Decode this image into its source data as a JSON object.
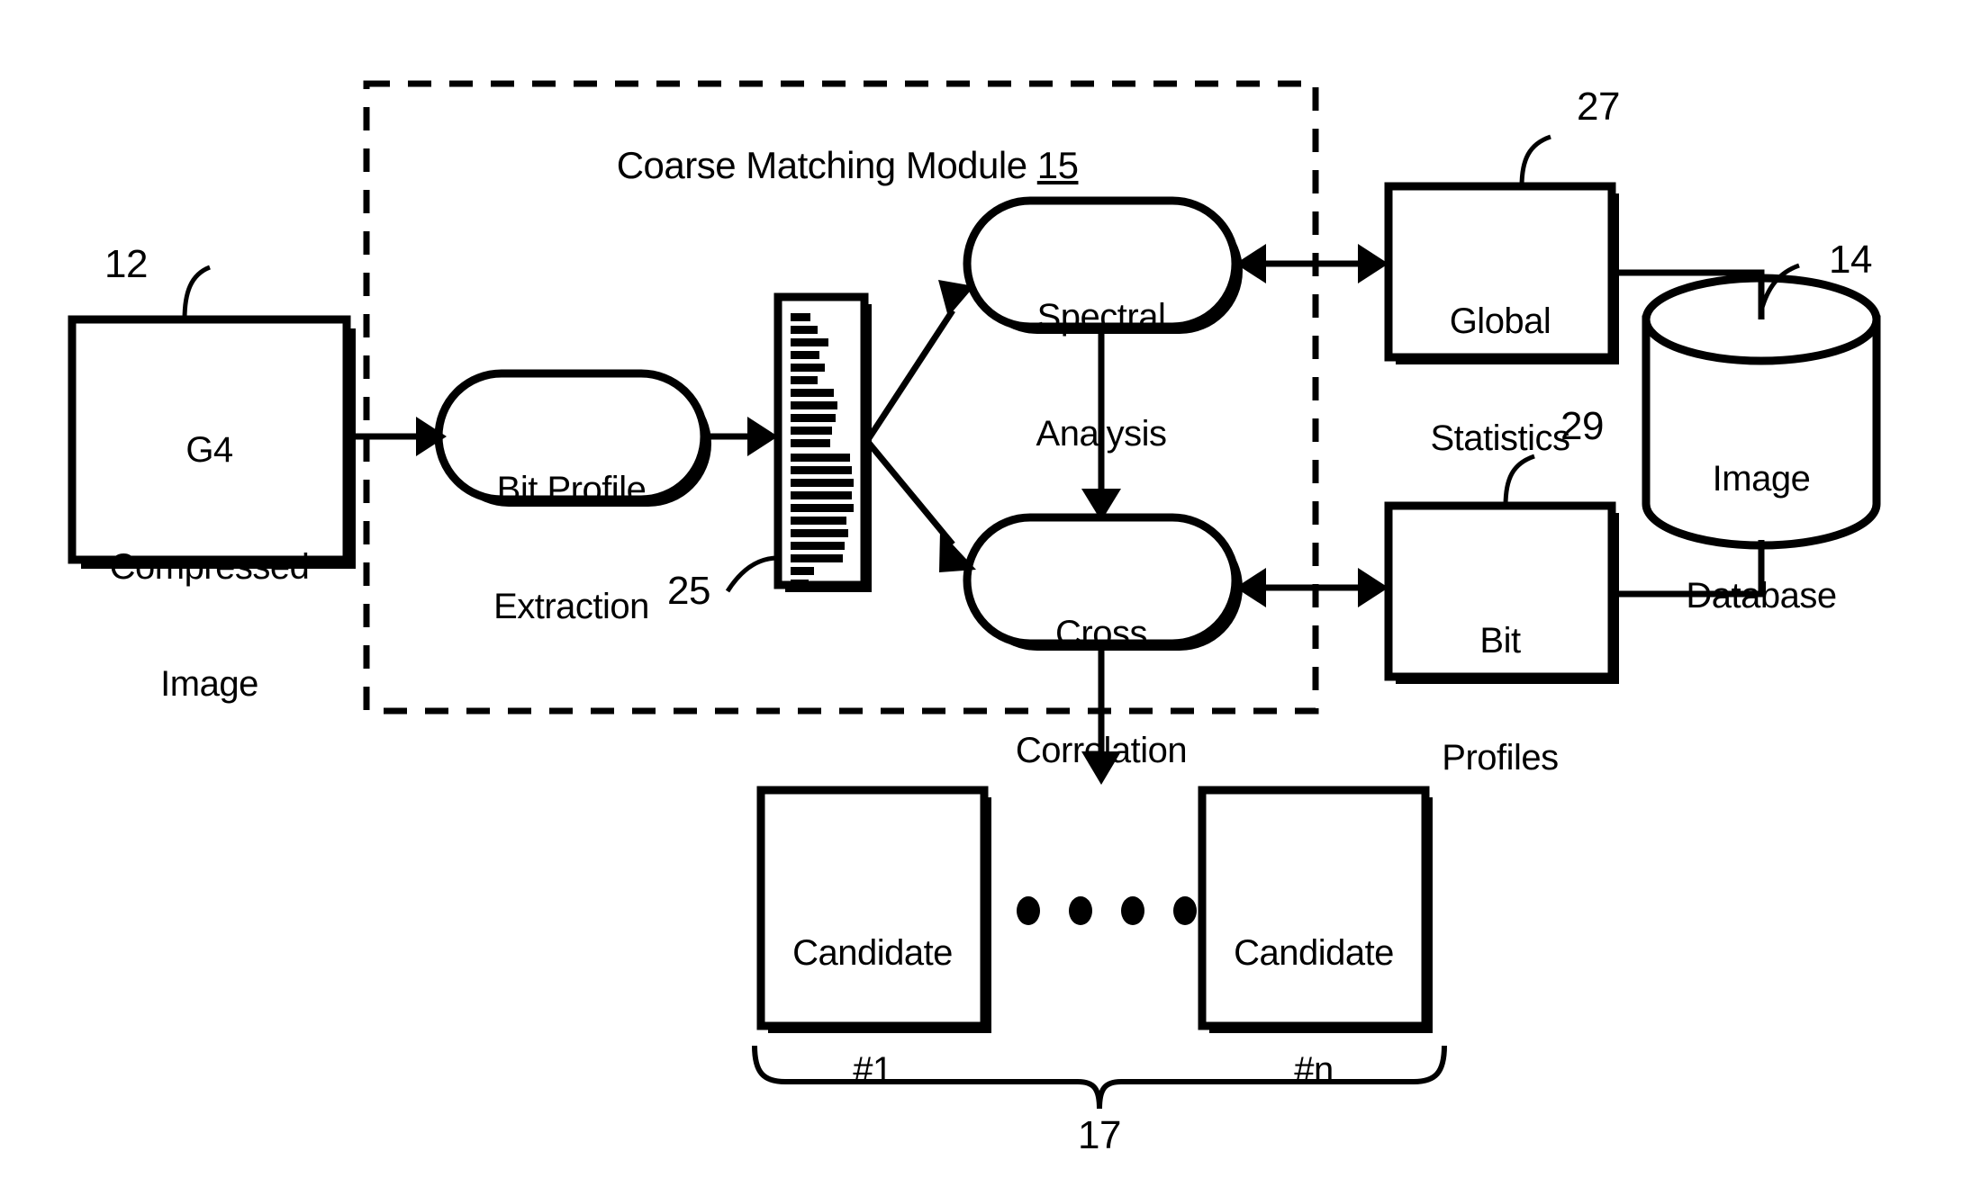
{
  "figure": {
    "module_box": {
      "title_prefix": "Coarse Matching Module ",
      "title_ref": "15"
    },
    "nodes": [
      {
        "id": "g4",
        "label": "G4\nCompressed\nImage",
        "ref": "12",
        "shape": "rectangle"
      },
      {
        "id": "bit_profile_extraction",
        "label": "Bit Profile\nExtraction",
        "shape": "stadium"
      },
      {
        "id": "bit_profile_graphic",
        "label": "",
        "ref": "25",
        "shape": "profile-bar"
      },
      {
        "id": "spectral_analysis",
        "label": "Spectral\nAnalysis",
        "shape": "stadium"
      },
      {
        "id": "cross_correlation",
        "label": "Cross\nCorrelation",
        "shape": "stadium"
      },
      {
        "id": "global_statistics",
        "label": "Global\nStatistics",
        "ref": "27",
        "shape": "rectangle"
      },
      {
        "id": "bit_profiles",
        "label": "Bit\nProfiles",
        "ref": "29",
        "shape": "rectangle"
      },
      {
        "id": "image_database",
        "label": "Image\nDatabase",
        "ref": "14",
        "shape": "cylinder"
      },
      {
        "id": "candidate_1",
        "label": "Candidate\n#1",
        "shape": "rectangle"
      },
      {
        "id": "candidate_n",
        "label": "Candidate\n#n",
        "shape": "rectangle"
      }
    ],
    "ellipsis_dots": 4,
    "candidates_group_ref": "17",
    "node_labels": {
      "g4_line1": "G4",
      "g4_line2": "Compressed",
      "g4_line3": "Image",
      "bpe_line1": "Bit Profile",
      "bpe_line2": "Extraction",
      "spectral_line1": "Spectral",
      "spectral_line2": "Analysis",
      "cross_line1": "Cross",
      "cross_line2": "Correlation",
      "global_line1": "Global",
      "global_line2": "Statistics",
      "bitprofiles_line1": "Bit",
      "bitprofiles_line2": "Profiles",
      "db_line1": "Image",
      "db_line2": "Database",
      "cand1_line1": "Candidate",
      "cand1_line2": "#1",
      "candn_line1": "Candidate",
      "candn_line2": "#n"
    },
    "reference_numerals": {
      "g4": "12",
      "database": "14",
      "module": "15",
      "candidates": "17",
      "bit_profile": "25",
      "global_statistics": "27",
      "bit_profiles": "29"
    },
    "colors": {
      "ink": "#000000",
      "paper": "#ffffff"
    }
  }
}
